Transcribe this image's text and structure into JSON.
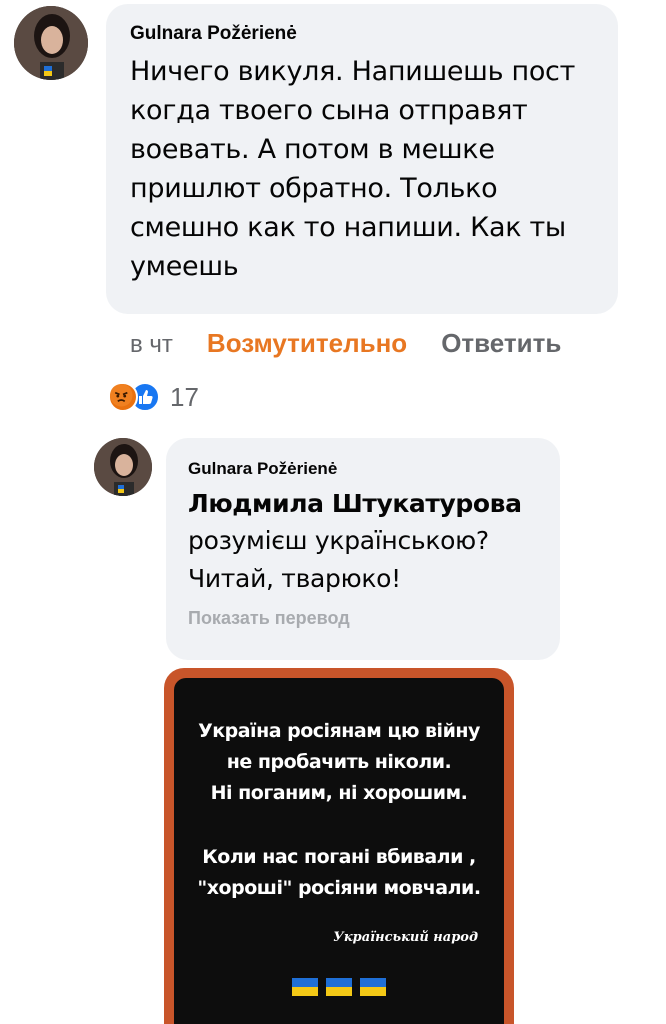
{
  "comment1": {
    "author": "Gulnara Požėrienė",
    "text": "Ничего викуля. Напишешь пост когда твоего сына отправят воевать. А потом в мешке пришлют обратно. Только смешно как то напиши. Как ты умеешь",
    "time": "в чт",
    "reaction_label": "Возмутительно",
    "reply_label": "Ответить",
    "reaction_icons": [
      "angry-icon",
      "like-icon"
    ],
    "reaction_count": "17"
  },
  "comment2": {
    "author": "Gulnara Požėrienė",
    "mention": "Людмила Штукатурова",
    "text": "розумієш українською? Читай, тварюко!",
    "translate_label": "Показать перевод"
  },
  "poster": {
    "lines1": [
      "Україна росіянам цю війну",
      "не пробачить ніколи.",
      "Ні поганим, ні хорошим."
    ],
    "lines2": [
      "Коли нас погані вбивали ,",
      "\"хороші\" росіяни мовчали."
    ],
    "signature": "Український народ",
    "flags": [
      "ukraine-flag-icon",
      "ukraine-flag-icon",
      "ukraine-flag-icon"
    ]
  },
  "colors": {
    "bubble": "#f0f2f5",
    "reaction_orange": "#e87722",
    "muted": "#65676b",
    "poster_frame": "#c8552a"
  }
}
